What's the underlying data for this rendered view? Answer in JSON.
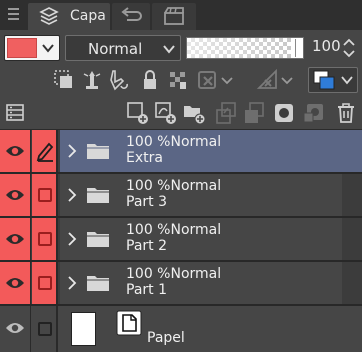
{
  "tabs": [
    {
      "label": "Capa",
      "icon": "layers-icon",
      "active": true
    },
    {
      "label": "",
      "icon": "history-icon",
      "active": false
    },
    {
      "label": "",
      "icon": "animation-icon",
      "active": false
    }
  ],
  "toolbar": {
    "layer_color": "#f06060",
    "blend_mode": "Normal",
    "opacity": 100,
    "opacity_label": "100",
    "row2_icons": [
      "clip-to-layer-icon",
      "reference-layer-icon",
      "selection-layer-icon",
      "lock-layer-icon",
      "lock-transparency-icon",
      "mask-enable-icon",
      "ruler-display-icon",
      "color-mode-icon"
    ],
    "row3_icons": [
      "layer-property-icon",
      "new-raster-layer-icon",
      "new-vector-layer-icon",
      "new-folder-icon",
      "transfer-down-icon",
      "merge-down-icon",
      "mask-icon",
      "apply-mask-icon",
      "delete-layer-icon"
    ]
  },
  "layers": [
    {
      "opacity": "100 %",
      "mode": "Normal",
      "name": "Extra",
      "type": "folder",
      "selected": true,
      "editing": true
    },
    {
      "opacity": "100 %",
      "mode": "Normal",
      "name": "Part 3",
      "type": "folder",
      "selected": false,
      "editing": false
    },
    {
      "opacity": "100 %",
      "mode": "Normal",
      "name": "Part 2",
      "type": "folder",
      "selected": false,
      "editing": false
    },
    {
      "opacity": "100 %",
      "mode": "Normal",
      "name": "Part 1",
      "type": "folder",
      "selected": false,
      "editing": false
    }
  ],
  "paper": {
    "name": "Papel"
  },
  "colors": {
    "layer_color": "#f35a5a",
    "selected_row": "#5b6685",
    "panel_bg": "#464646"
  }
}
